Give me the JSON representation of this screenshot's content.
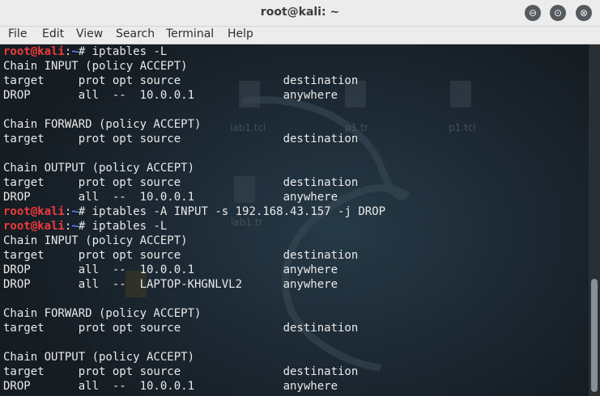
{
  "window": {
    "title": "root@kali: ~",
    "minimize_glyph": "⊖",
    "maximize_glyph": "⊙",
    "close_glyph": "⊗"
  },
  "menu": [
    "File",
    "Edit",
    "View",
    "Search",
    "Terminal",
    "Help"
  ],
  "desktop_icons": [
    "lab1.tcl",
    "p1.tr",
    "p1.tcl",
    "lab1.tr"
  ],
  "terminal": {
    "lines": [
      {
        "type": "prompt",
        "user": "root@kali",
        "path": "~",
        "symbol": "#",
        "cmd": " iptables -L"
      },
      {
        "type": "text",
        "text": "Chain INPUT (policy ACCEPT)"
      },
      {
        "type": "text",
        "text": "target     prot opt source               destination"
      },
      {
        "type": "text",
        "text": "DROP       all  --  10.0.0.1             anywhere"
      },
      {
        "type": "text",
        "text": ""
      },
      {
        "type": "text",
        "text": "Chain FORWARD (policy ACCEPT)"
      },
      {
        "type": "text",
        "text": "target     prot opt source               destination"
      },
      {
        "type": "text",
        "text": ""
      },
      {
        "type": "text",
        "text": "Chain OUTPUT (policy ACCEPT)"
      },
      {
        "type": "text",
        "text": "target     prot opt source               destination"
      },
      {
        "type": "text",
        "text": "DROP       all  --  10.0.0.1             anywhere"
      },
      {
        "type": "prompt",
        "user": "root@kali",
        "path": "~",
        "symbol": "#",
        "cmd": " iptables -A INPUT -s 192.168.43.157 -j DROP"
      },
      {
        "type": "prompt",
        "user": "root@kali",
        "path": "~",
        "symbol": "#",
        "cmd": " iptables -L"
      },
      {
        "type": "text",
        "text": "Chain INPUT (policy ACCEPT)"
      },
      {
        "type": "text",
        "text": "target     prot opt source               destination"
      },
      {
        "type": "text",
        "text": "DROP       all  --  10.0.0.1             anywhere"
      },
      {
        "type": "text",
        "text": "DROP       all  --  LAPTOP-KHGNLVL2      anywhere"
      },
      {
        "type": "text",
        "text": ""
      },
      {
        "type": "text",
        "text": "Chain FORWARD (policy ACCEPT)"
      },
      {
        "type": "text",
        "text": "target     prot opt source               destination"
      },
      {
        "type": "text",
        "text": ""
      },
      {
        "type": "text",
        "text": "Chain OUTPUT (policy ACCEPT)"
      },
      {
        "type": "text",
        "text": "target     prot opt source               destination"
      },
      {
        "type": "text",
        "text": "DROP       all  --  10.0.0.1             anywhere"
      }
    ]
  },
  "colors": {
    "prompt_user": "#ef3a3a",
    "prompt_path": "#5f86ff",
    "text": "#eaeaea"
  }
}
